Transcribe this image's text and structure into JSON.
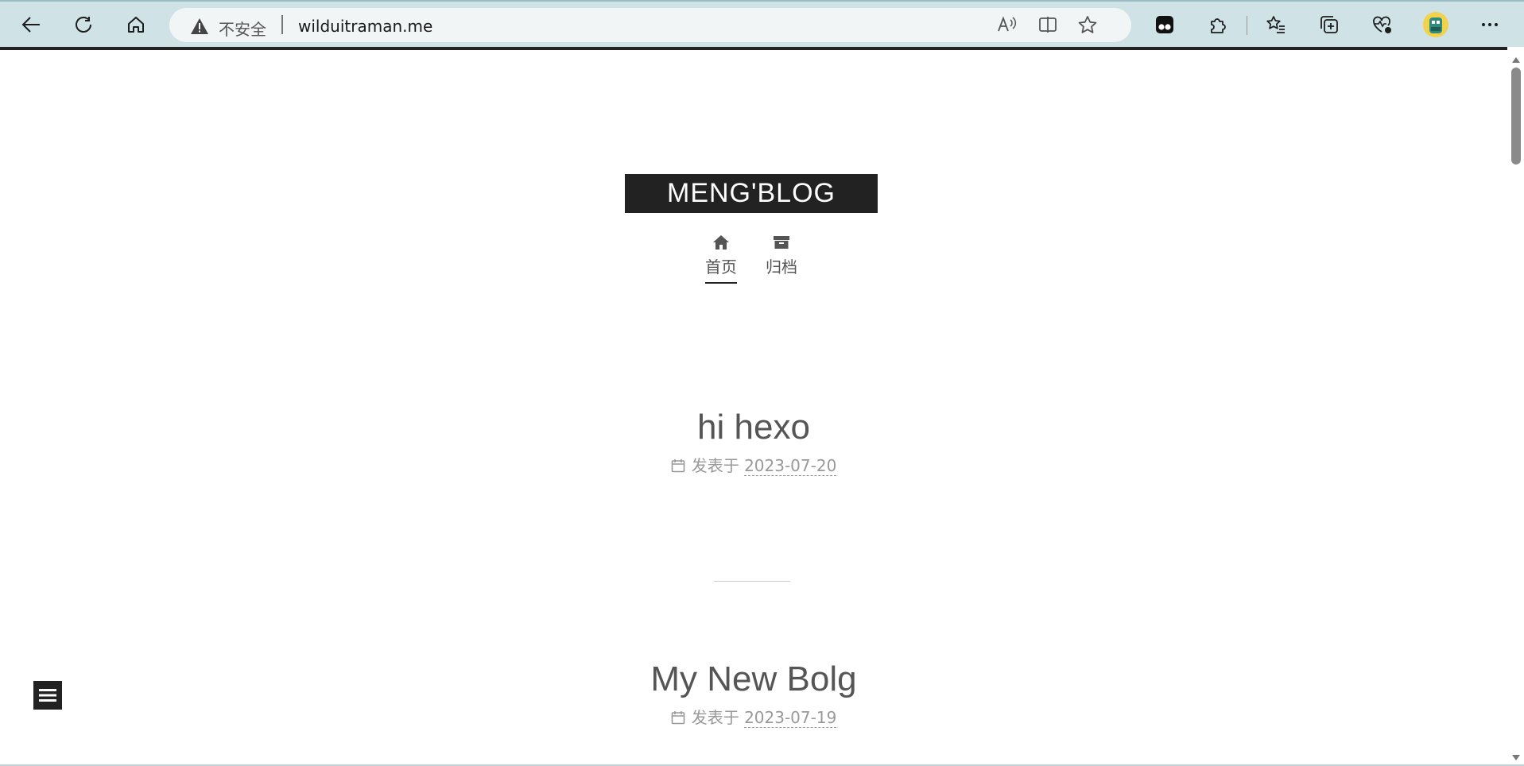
{
  "browser": {
    "security_label": "不安全",
    "url": "wilduitraman.me"
  },
  "site": {
    "title": "MENG'BLOG"
  },
  "menu": [
    {
      "label": "首页",
      "icon": "home-icon",
      "active": true
    },
    {
      "label": "归档",
      "icon": "archive-icon",
      "active": false
    }
  ],
  "posts": [
    {
      "title": "hi hexo",
      "meta_prefix": "发表于",
      "date": "2023-07-20"
    },
    {
      "title": "My New Bolg",
      "meta_prefix": "发表于",
      "date": "2023-07-19"
    }
  ],
  "colors": {
    "brand_block": "#222222",
    "text": "#555555",
    "meta": "#999999"
  }
}
